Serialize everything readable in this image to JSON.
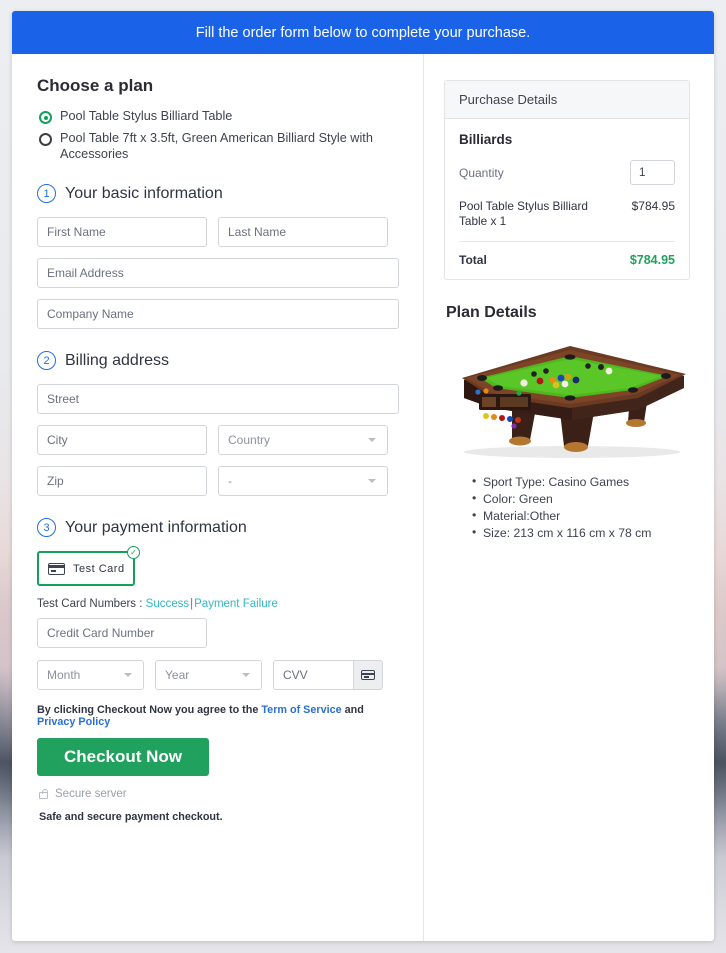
{
  "banner": {
    "text": "Fill the order form below to complete your purchase."
  },
  "plan": {
    "heading": "Choose a plan",
    "options": [
      {
        "label": "Pool Table Stylus Billiard Table",
        "selected": true
      },
      {
        "label": "Pool Table 7ft x 3.5ft, Green American Billiard Style with Accessories",
        "selected": false
      }
    ]
  },
  "steps": {
    "basic": {
      "number": "1",
      "title": "Your basic information",
      "fields": {
        "first_name": "First Name",
        "last_name": "Last Name",
        "email": "Email Address",
        "company": "Company Name"
      }
    },
    "billing": {
      "number": "2",
      "title": "Billing address",
      "fields": {
        "street": "Street",
        "city": "City",
        "country": "Country",
        "zip": "Zip",
        "state": "-"
      }
    },
    "payment": {
      "number": "3",
      "title": "Your payment information",
      "card_option_label": "Test Card",
      "card_option_selected": true,
      "test_numbers_label": "Test Card Numbers :",
      "link_success": "Success",
      "link_separator": "|",
      "link_failure": "Payment Failure",
      "fields": {
        "card_number": "Credit Card Number",
        "month": "Month",
        "year": "Year",
        "cvv": "CVV"
      }
    }
  },
  "footer": {
    "agree_prefix": "By clicking Checkout Now you agree to the",
    "terms_link": "Term of Service",
    "agree_and": "and",
    "privacy_link": "Privacy Policy",
    "checkout_label": "Checkout Now",
    "secure_server": "Secure server",
    "safe_note": "Safe and secure payment checkout."
  },
  "purchase": {
    "header": "Purchase Details",
    "category": "Billiards",
    "quantity_label": "Quantity",
    "quantity_value": "1",
    "item_name": "Pool Table Stylus Billiard Table x 1",
    "item_price": "$784.95",
    "total_label": "Total",
    "total_value": "$784.95"
  },
  "plan_details": {
    "title": "Plan Details",
    "image_alt": "pool-table-image",
    "specs": [
      "Sport Type: Casino Games",
      "Color: Green",
      "Material:Other",
      "Size: 213 cm x 116 cm x 78 cm"
    ]
  },
  "colors": {
    "banner_blue": "#1a63e8",
    "accent_green": "#21a15e",
    "step_blue": "#1f6fe0",
    "link_teal": "#33b6c4",
    "link_blue": "#2a6fd6",
    "felt_green": "#4fb81e"
  }
}
